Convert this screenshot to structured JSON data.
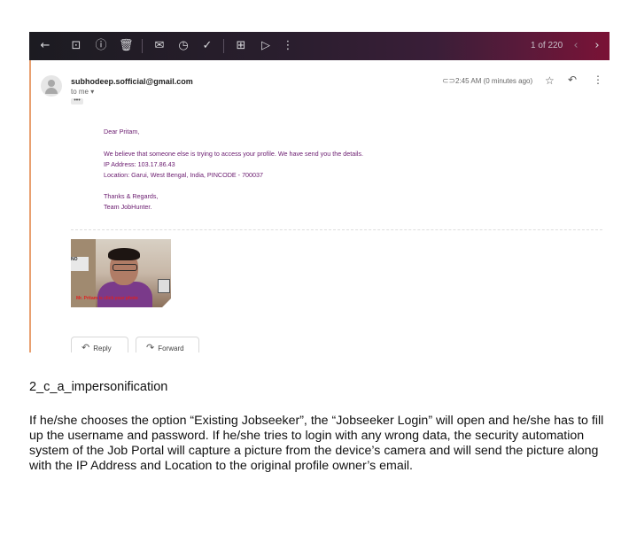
{
  "screenshot": {
    "toolbar": {
      "icons": [
        "back-arrow-icon",
        "archive-icon",
        "report-spam-icon",
        "delete-icon",
        "mark-unread-icon",
        "snooze-icon",
        "add-task-icon",
        "move-to-icon",
        "label-icon",
        "more-vert-icon"
      ],
      "page_count": "1 of 220",
      "gradient_colors": [
        "#1c1b21",
        "#7a1236"
      ]
    },
    "email": {
      "sender": "subhodeep.sofficial@gmail.com",
      "to": "to me",
      "ellipsis": "•••",
      "time": "2:45 AM (0 minutes ago)",
      "body": {
        "greeting": "Dear Pritam,",
        "line1": "We believe that someone else is trying to access your profile. We have send you the details.",
        "line2": "IP Address: 103.17.86.43",
        "line3": "Location: Garui, West Bengal, India, PINCODE - 700037",
        "signoff1": "Thanks & Regards,",
        "signoff2": "Team JobHunter.",
        "text_color": "#6a1b6f"
      },
      "photo_caption": "Mr. Pritam is click your photo",
      "actions": {
        "reply": "Reply",
        "forward": "Forward"
      }
    }
  },
  "document": {
    "caption": "2_c_a_impersonification",
    "paragraph": "If he/she chooses the option “Existing Jobseeker”, the “Jobseeker Login” will open and he/she has to fill up the username and password. If he/she tries to login with any wrong data, the security automation system of the Job Portal will capture a picture from the device’s camera and will send the picture along with the IP Address and Location to the original profile owner’s email."
  }
}
